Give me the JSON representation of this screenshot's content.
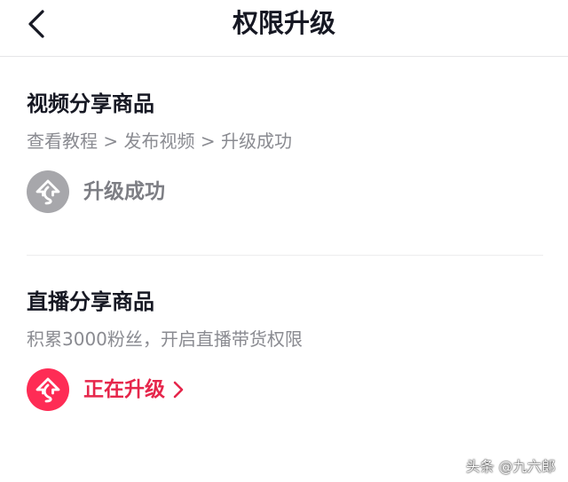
{
  "header": {
    "title": "权限升级"
  },
  "sections": [
    {
      "title": "视频分享商品",
      "description": "查看教程 > 发布视频 > 升级成功",
      "status_label": "升级成功",
      "status": "completed"
    },
    {
      "title": "直播分享商品",
      "description": "积累3000粉丝，开启直播带货权限",
      "status_label": "正在升级",
      "status": "in-progress"
    }
  ],
  "watermark": "头条 @九六郎",
  "colors": {
    "accent": "#fe2c55",
    "completed_icon_bg": "#a7a7ab",
    "title_text": "#161823",
    "secondary_text": "#8a8b91"
  },
  "icons": {
    "back": "chevron-left-icon",
    "upgrade": "upgrade-arrow-icon",
    "more": "chevron-right-icon"
  }
}
